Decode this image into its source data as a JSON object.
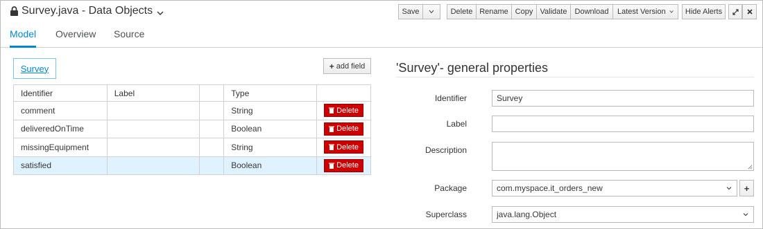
{
  "header": {
    "title": "Survey.java - Data Objects",
    "toolbar": {
      "save": "Save",
      "delete": "Delete",
      "rename": "Rename",
      "copy": "Copy",
      "validate": "Validate",
      "download": "Download",
      "latest_version": "Latest Version",
      "hide_alerts": "Hide Alerts"
    }
  },
  "tabs": [
    {
      "label": "Model",
      "active": true
    },
    {
      "label": "Overview",
      "active": false
    },
    {
      "label": "Source",
      "active": false
    }
  ],
  "left": {
    "object_name": "Survey",
    "add_field_label": "add field",
    "columns": [
      "Identifier",
      "Label",
      "",
      "Type",
      ""
    ],
    "delete_label": "Delete",
    "rows": [
      {
        "identifier": "comment",
        "label": "",
        "type": "String"
      },
      {
        "identifier": "deliveredOnTime",
        "label": "",
        "type": "Boolean"
      },
      {
        "identifier": "missingEquipment",
        "label": "",
        "type": "String"
      },
      {
        "identifier": "satisfied",
        "label": "",
        "type": "Boolean",
        "selected": true
      }
    ]
  },
  "right": {
    "title": "'Survey'- general properties",
    "identifier_label": "Identifier",
    "identifier_value": "Survey",
    "label_label": "Label",
    "label_value": "",
    "description_label": "Description",
    "description_value": "",
    "package_label": "Package",
    "package_value": "com.myspace.it_orders_new",
    "superclass_label": "Superclass",
    "superclass_value": "java.lang.Object"
  },
  "colors": {
    "accent": "#0088ce",
    "delete": "#cc0000",
    "selected_row": "#def3ff"
  },
  "icons": [
    "lock-icon",
    "chevron-down-icon",
    "expand-icon",
    "close-icon",
    "plus-icon",
    "trash-icon",
    "resize-handle-icon"
  ]
}
